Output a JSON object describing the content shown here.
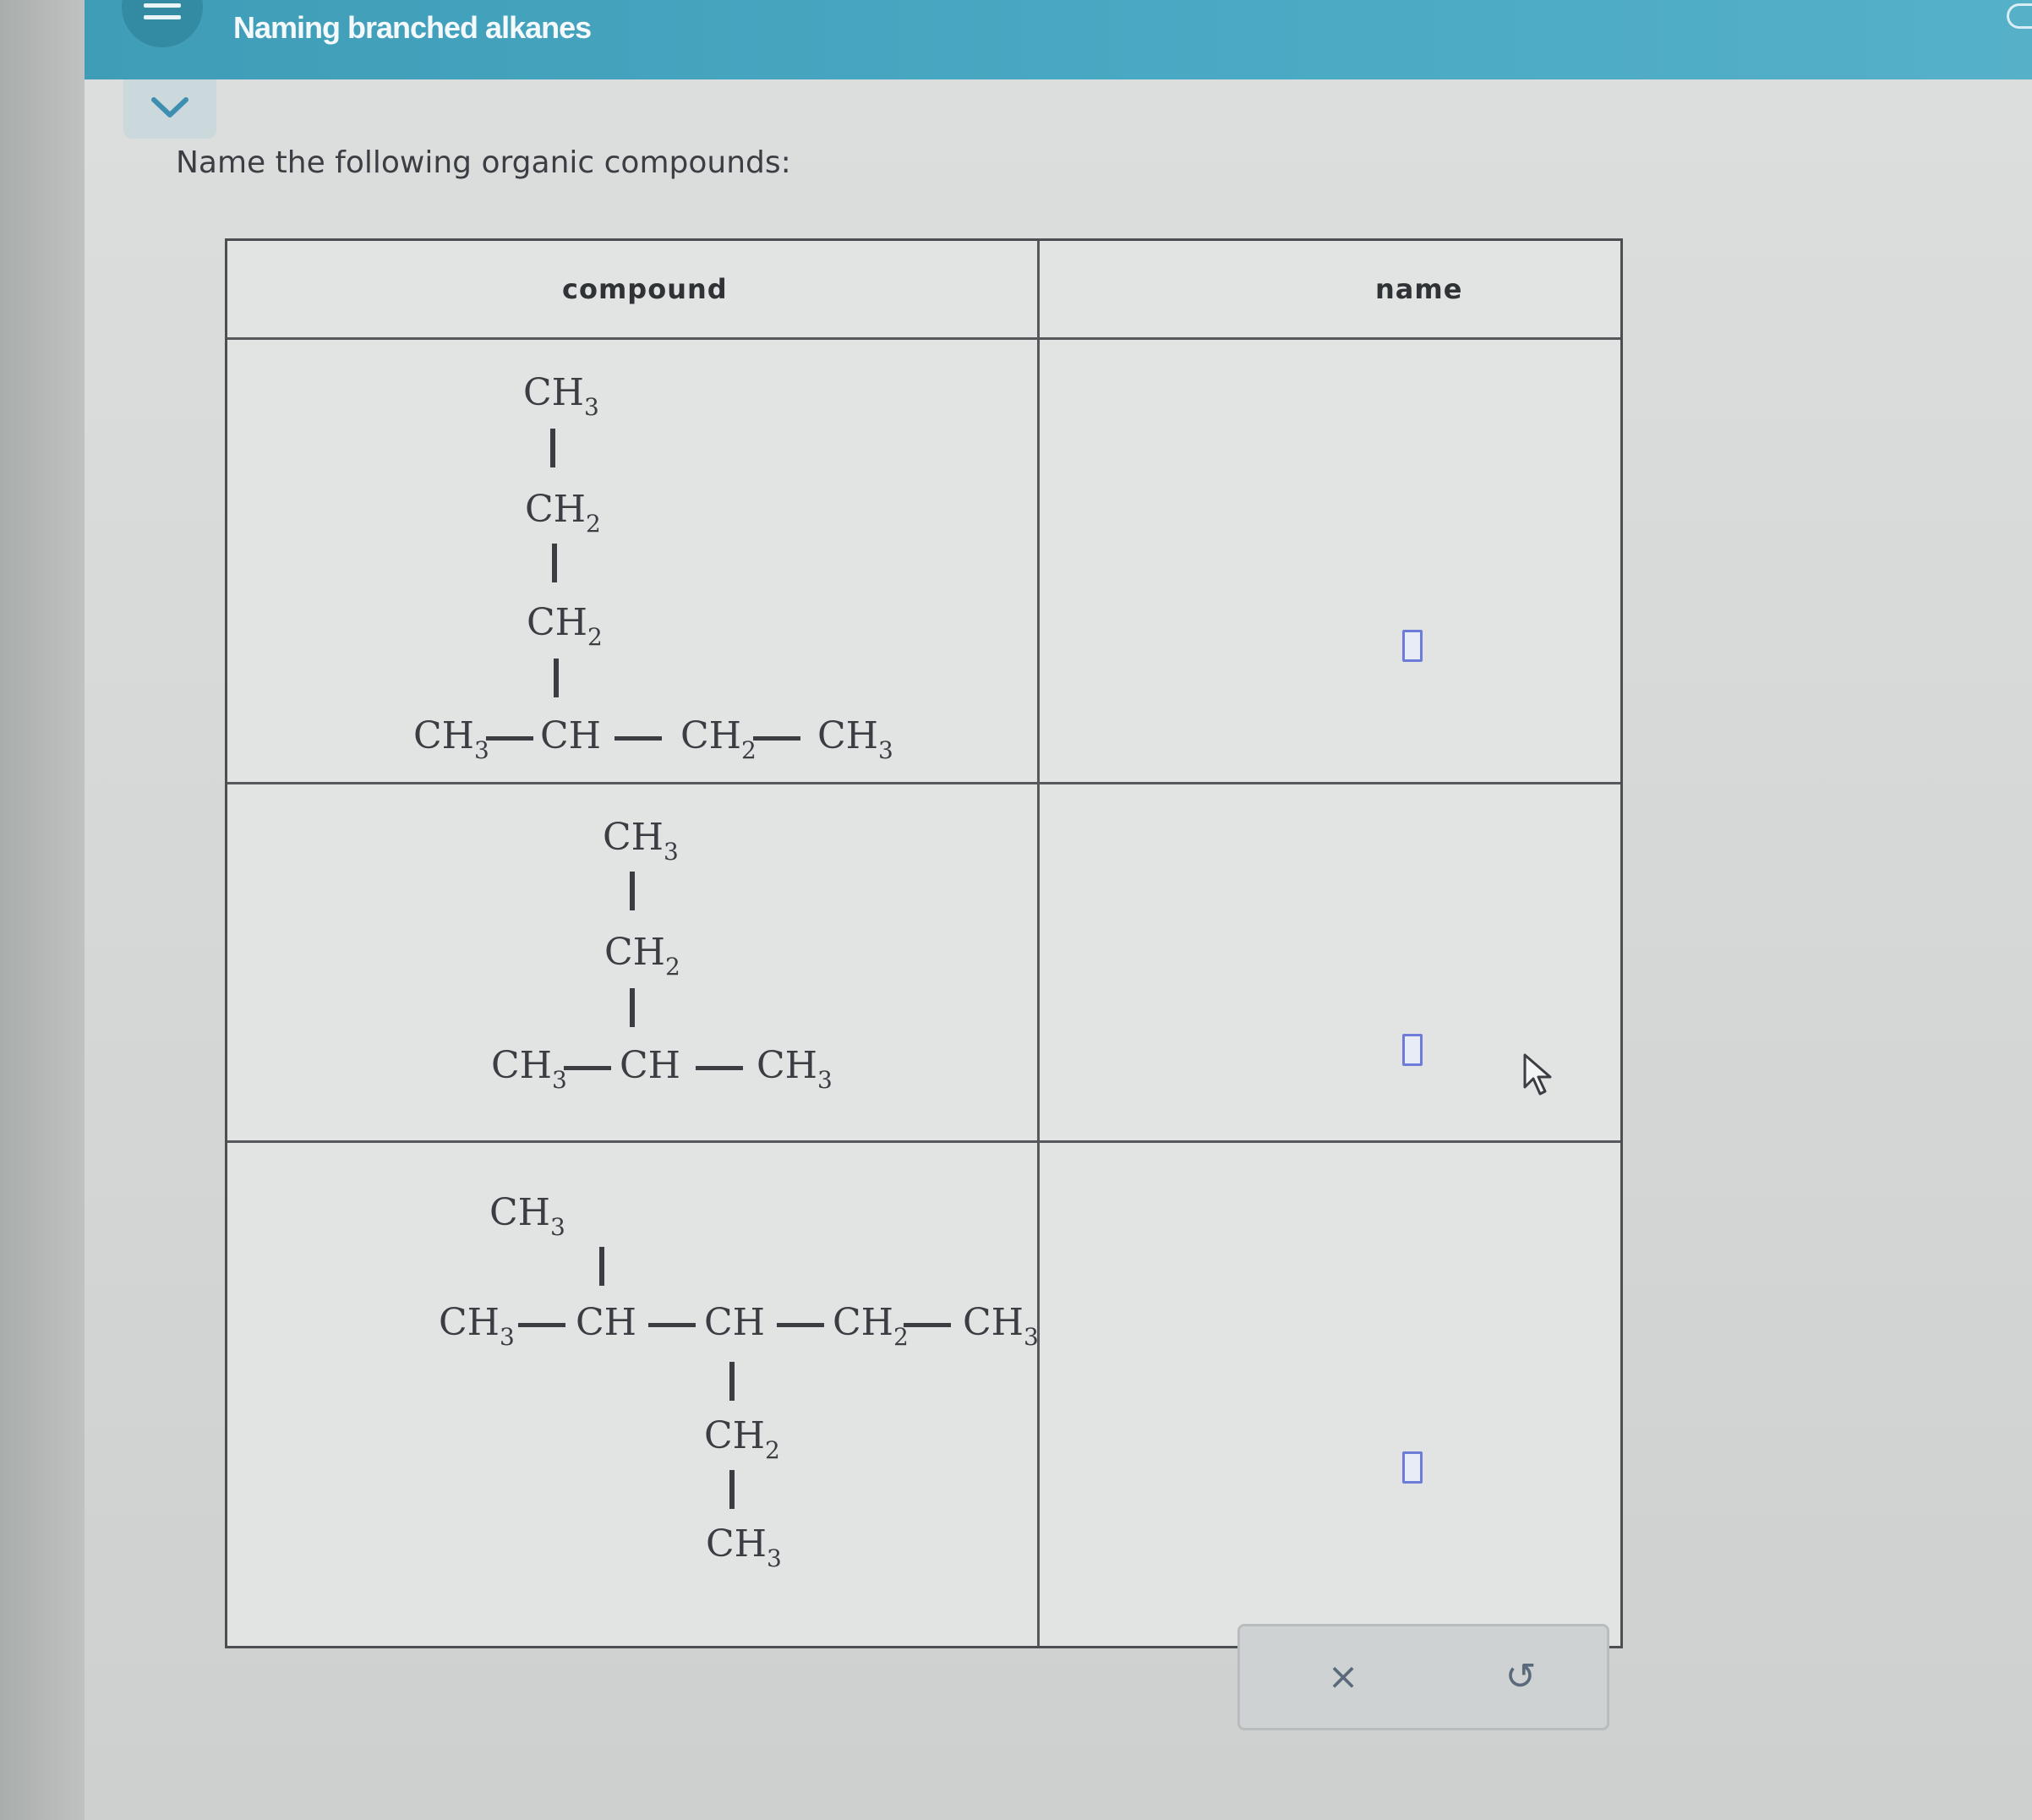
{
  "header": {
    "title": "Naming branched alkanes",
    "menu_icon": "hamburger-menu-icon",
    "collapse_icon": "chevron-down-icon"
  },
  "prompt": "Name the following organic compounds:",
  "table": {
    "headers": {
      "compound": "compound",
      "name": "name"
    },
    "rows": [
      {
        "groups": [
          "CH",
          "3",
          "CH",
          "2",
          "CH",
          "2",
          "CH",
          "3",
          "CH",
          "CH",
          "2",
          "CH",
          "3"
        ],
        "answer": ""
      },
      {
        "groups": [
          "CH",
          "3",
          "CH",
          "2",
          "CH",
          "3",
          "CH",
          "CH",
          "3"
        ],
        "answer": ""
      },
      {
        "groups": [
          "CH",
          "3",
          "CH",
          "3",
          "CH",
          "CH",
          "CH",
          "2",
          "CH",
          "3",
          "CH",
          "2",
          "CH",
          "3"
        ],
        "answer": ""
      }
    ]
  },
  "toolbar": {
    "clear_label": "×",
    "undo_label": "↺"
  },
  "colors": {
    "header": "#4aa9c4",
    "answer_box": "#6c7cd8"
  }
}
